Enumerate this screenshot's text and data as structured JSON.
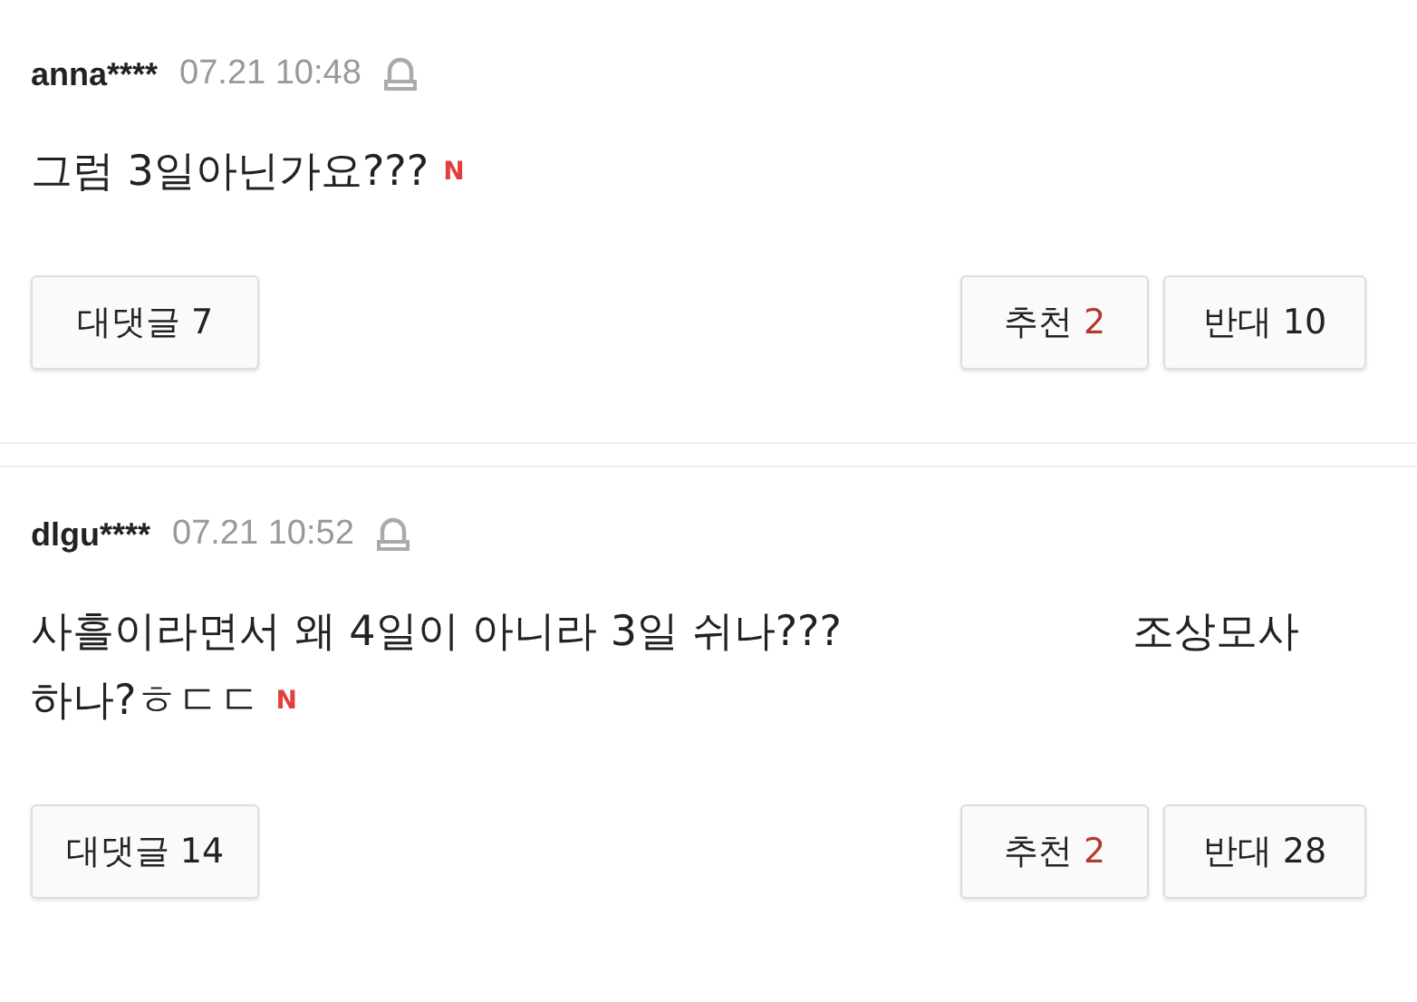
{
  "comments": [
    {
      "author": "anna****",
      "time": "07.21 10:48",
      "body_lines": [
        [
          "그럼 3일아닌가요???"
        ]
      ],
      "is_new": true,
      "new_badge": "N",
      "replies_label": "대댓글",
      "replies": "7",
      "like_label": "추천",
      "likes": "2",
      "dislike_label": "반대",
      "dislikes": "10"
    },
    {
      "author": "dlgu****",
      "time": "07.21 10:52",
      "body_lines": [
        [
          "사흘이라면서 왜 4일이 아니라 3일 쉬나???",
          "조상모사"
        ],
        [
          "하나?ㅎㄷㄷ"
        ]
      ],
      "is_new": true,
      "new_badge": "N",
      "replies_label": "대댓글",
      "replies": "14",
      "like_label": "추천",
      "likes": "2",
      "dislike_label": "반대",
      "dislikes": "28"
    }
  ]
}
